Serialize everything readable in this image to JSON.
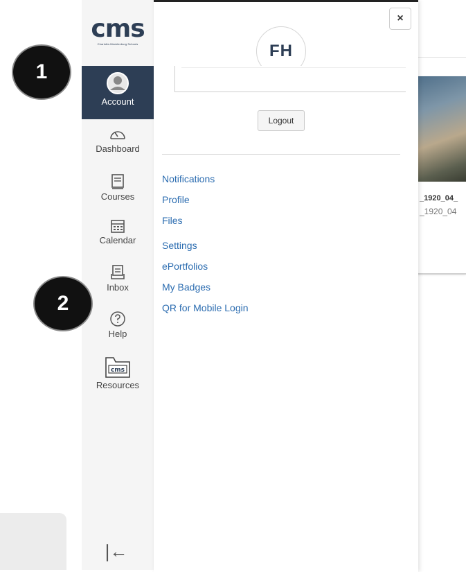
{
  "annotations": {
    "badge_1": "1",
    "badge_2": "2"
  },
  "logo": {
    "word": "cms",
    "subtitle": "Charlotte-Mecklenburg Schools"
  },
  "nav": {
    "account": "Account",
    "dashboard": "Dashboard",
    "courses": "Courses",
    "calendar": "Calendar",
    "inbox": "Inbox",
    "help": "Help",
    "resources": "Resources",
    "resources_icon_text": "cms",
    "collapse": "|←"
  },
  "tray": {
    "close": "×",
    "avatar_initials": "FH",
    "logout": "Logout",
    "links": [
      "Notifications",
      "Profile",
      "Files",
      "Settings",
      "ePortfolios",
      "My Badges",
      "QR for Mobile Login"
    ]
  },
  "background_course": {
    "title": "_1920_04_",
    "subtitle": "_1920_04"
  },
  "colors": {
    "nav_active": "#2d3e55",
    "link": "#2b6cb0",
    "logo": "#2d3e55"
  }
}
